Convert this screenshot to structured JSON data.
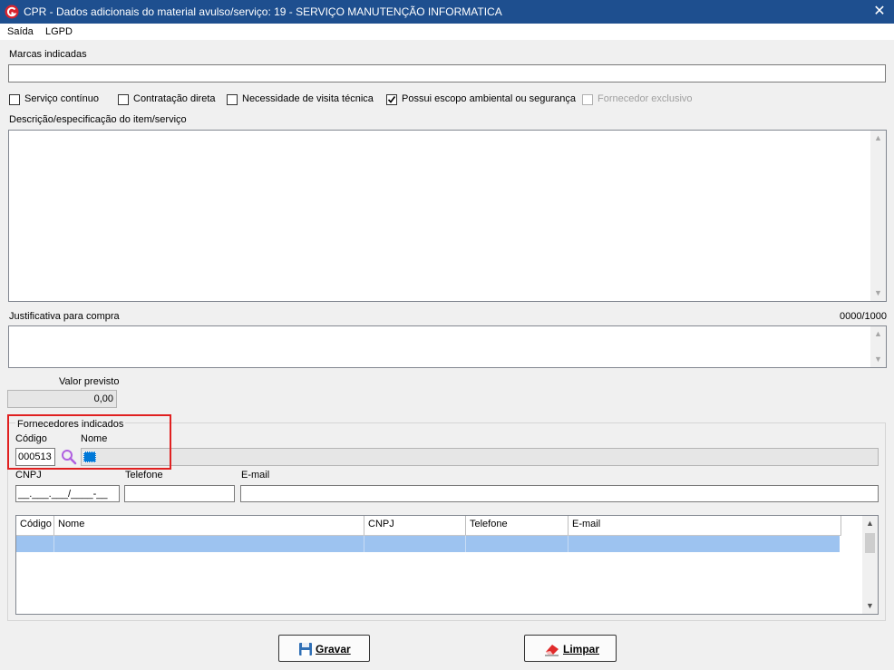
{
  "window": {
    "title": "CPR - Dados adicionais do material avulso/serviço: 19 - SERVIÇO MANUTENÇÃO INFORMATICA",
    "close_glyph": "✕"
  },
  "menu": {
    "items": [
      "Saída",
      "LGPD"
    ]
  },
  "marcas": {
    "label": "Marcas indicadas",
    "value": ""
  },
  "checkboxes": [
    {
      "label": "Serviço contínuo",
      "checked": false,
      "enabled": true
    },
    {
      "label": "Contratação direta",
      "checked": false,
      "enabled": true
    },
    {
      "label": "Necessidade de visita técnica",
      "checked": false,
      "enabled": true
    },
    {
      "label": "Possui escopo ambiental ou segurança",
      "checked": true,
      "enabled": true
    },
    {
      "label": "Fornecedor exclusivo",
      "checked": false,
      "enabled": false
    }
  ],
  "descricao": {
    "label": "Descrição/especificação do item/serviço",
    "value": ""
  },
  "justificativa": {
    "label": "Justificativa para compra",
    "counter": "0000/1000",
    "value": ""
  },
  "valor": {
    "label": "Valor previsto",
    "value": "0,00"
  },
  "fornecedores": {
    "group_label": "Fornecedores indicados",
    "codigo_label": "Código",
    "codigo_value": "000513",
    "nome_label": "Nome",
    "nome_value": "",
    "cnpj_label": "CNPJ",
    "cnpj_mask": "__.___.___/____-__",
    "telefone_label": "Telefone",
    "telefone_value": "",
    "email_label": "E-mail",
    "email_value": "",
    "grid": {
      "columns": [
        "Código",
        "Nome",
        "CNPJ",
        "Telefone",
        "E-mail"
      ],
      "rows": []
    }
  },
  "buttons": {
    "gravar": "Gravar",
    "limpar": "Limpar"
  },
  "icons": {
    "app": "app-logo-icon",
    "search": "magnifier-icon",
    "save": "floppy-disk-icon",
    "clear": "eraser-icon"
  },
  "colors": {
    "titlebar": "#1e4f8f",
    "highlight": "#e02020",
    "selection": "#9dc3f0"
  }
}
